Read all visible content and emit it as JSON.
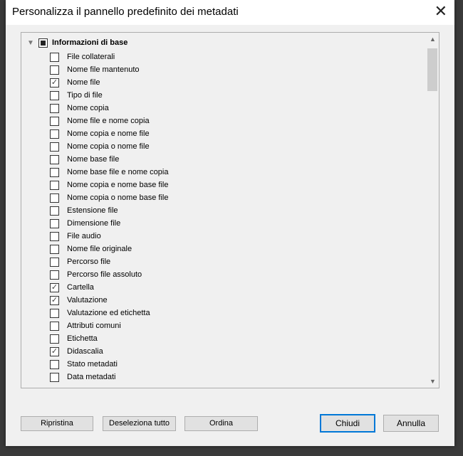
{
  "title": "Personalizza il pannello predefinito dei metadati",
  "group": {
    "label": "Informazioni di base"
  },
  "items": [
    {
      "label": "File collaterali",
      "checked": false
    },
    {
      "label": "Nome file mantenuto",
      "checked": false
    },
    {
      "label": "Nome file",
      "checked": true
    },
    {
      "label": "Tipo di file",
      "checked": false
    },
    {
      "label": "Nome copia",
      "checked": false
    },
    {
      "label": "Nome file e nome copia",
      "checked": false
    },
    {
      "label": "Nome copia e nome file",
      "checked": false
    },
    {
      "label": "Nome copia o nome file",
      "checked": false
    },
    {
      "label": "Nome base file",
      "checked": false
    },
    {
      "label": "Nome base file e nome copia",
      "checked": false
    },
    {
      "label": "Nome copia e nome base file",
      "checked": false
    },
    {
      "label": "Nome copia o nome base file",
      "checked": false
    },
    {
      "label": "Estensione file",
      "checked": false
    },
    {
      "label": "Dimensione file",
      "checked": false
    },
    {
      "label": "File audio",
      "checked": false
    },
    {
      "label": "Nome file originale",
      "checked": false
    },
    {
      "label": "Percorso file",
      "checked": false
    },
    {
      "label": "Percorso file assoluto",
      "checked": false
    },
    {
      "label": "Cartella",
      "checked": true
    },
    {
      "label": "Valutazione",
      "checked": true
    },
    {
      "label": "Valutazione ed etichetta",
      "checked": false
    },
    {
      "label": "Attributi comuni",
      "checked": false
    },
    {
      "label": "Etichetta",
      "checked": false
    },
    {
      "label": "Didascalia",
      "checked": true
    },
    {
      "label": "Stato metadati",
      "checked": false
    },
    {
      "label": "Data metadati",
      "checked": false
    }
  ],
  "buttons": {
    "reset": "Ripristina",
    "deselect_all": "Deseleziona tutto",
    "sort": "Ordina",
    "close": "Chiudi",
    "cancel": "Annulla"
  }
}
